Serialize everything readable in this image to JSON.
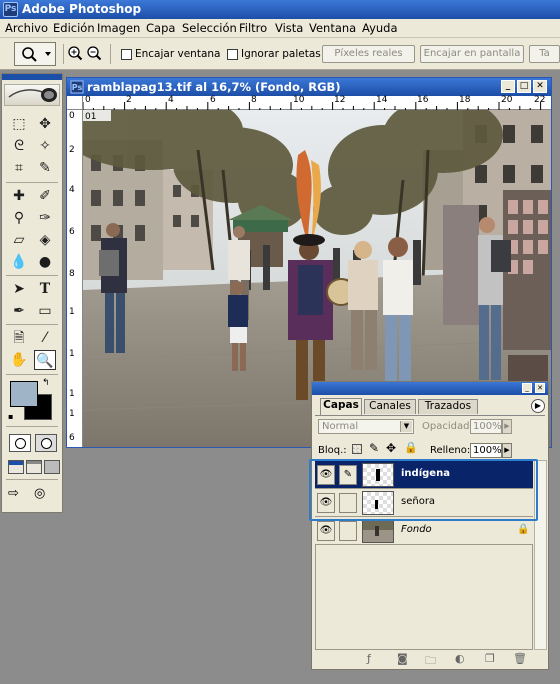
{
  "app": {
    "title": "Adobe Photoshop",
    "logo_letters": "Ps"
  },
  "menu": [
    "Archivo",
    "Edición",
    "Imagen",
    "Capa",
    "Selección",
    "Filtro",
    "Vista",
    "Ventana",
    "Ayuda"
  ],
  "options_bar": {
    "resize_window_label": "Encajar ventana",
    "ignore_palettes_label": "Ignorar paletas",
    "actual_pixels_label": "Píxeles reales",
    "fit_screen_label": "Encajar en pantalla",
    "print_size_label": "Ta"
  },
  "document": {
    "title": "ramblapag13.tif al 16,7% (Fondo, RGB)",
    "ruler_top": [
      "0",
      "2",
      "4",
      "6",
      "8",
      "10",
      "12",
      "14",
      "16",
      "18",
      "20",
      "22"
    ],
    "ruler_left": [
      "0",
      "2",
      "4",
      "6",
      "8",
      "1",
      "1",
      "1",
      "1",
      "6"
    ],
    "page_marker": "01"
  },
  "layers_palette": {
    "tabs": [
      "Capas",
      "Canales",
      "Trazados"
    ],
    "blend_mode": "Normal",
    "opacity_label": "Opacidad:",
    "opacity_value": "100%",
    "lock_label": "Bloq.:",
    "fill_label": "Relleno:",
    "fill_value": "100%",
    "layers": [
      {
        "name": "indígena",
        "selected": true
      },
      {
        "name": "señora",
        "selected": false
      },
      {
        "name": "Fondo",
        "selected": false,
        "locked": true
      }
    ]
  },
  "colors": {
    "title_bar": "#1c4fa8",
    "selection": "#0a246a",
    "highlight": "#2e7bc9",
    "foreground": "#9fb4c7",
    "background": "#000000"
  }
}
